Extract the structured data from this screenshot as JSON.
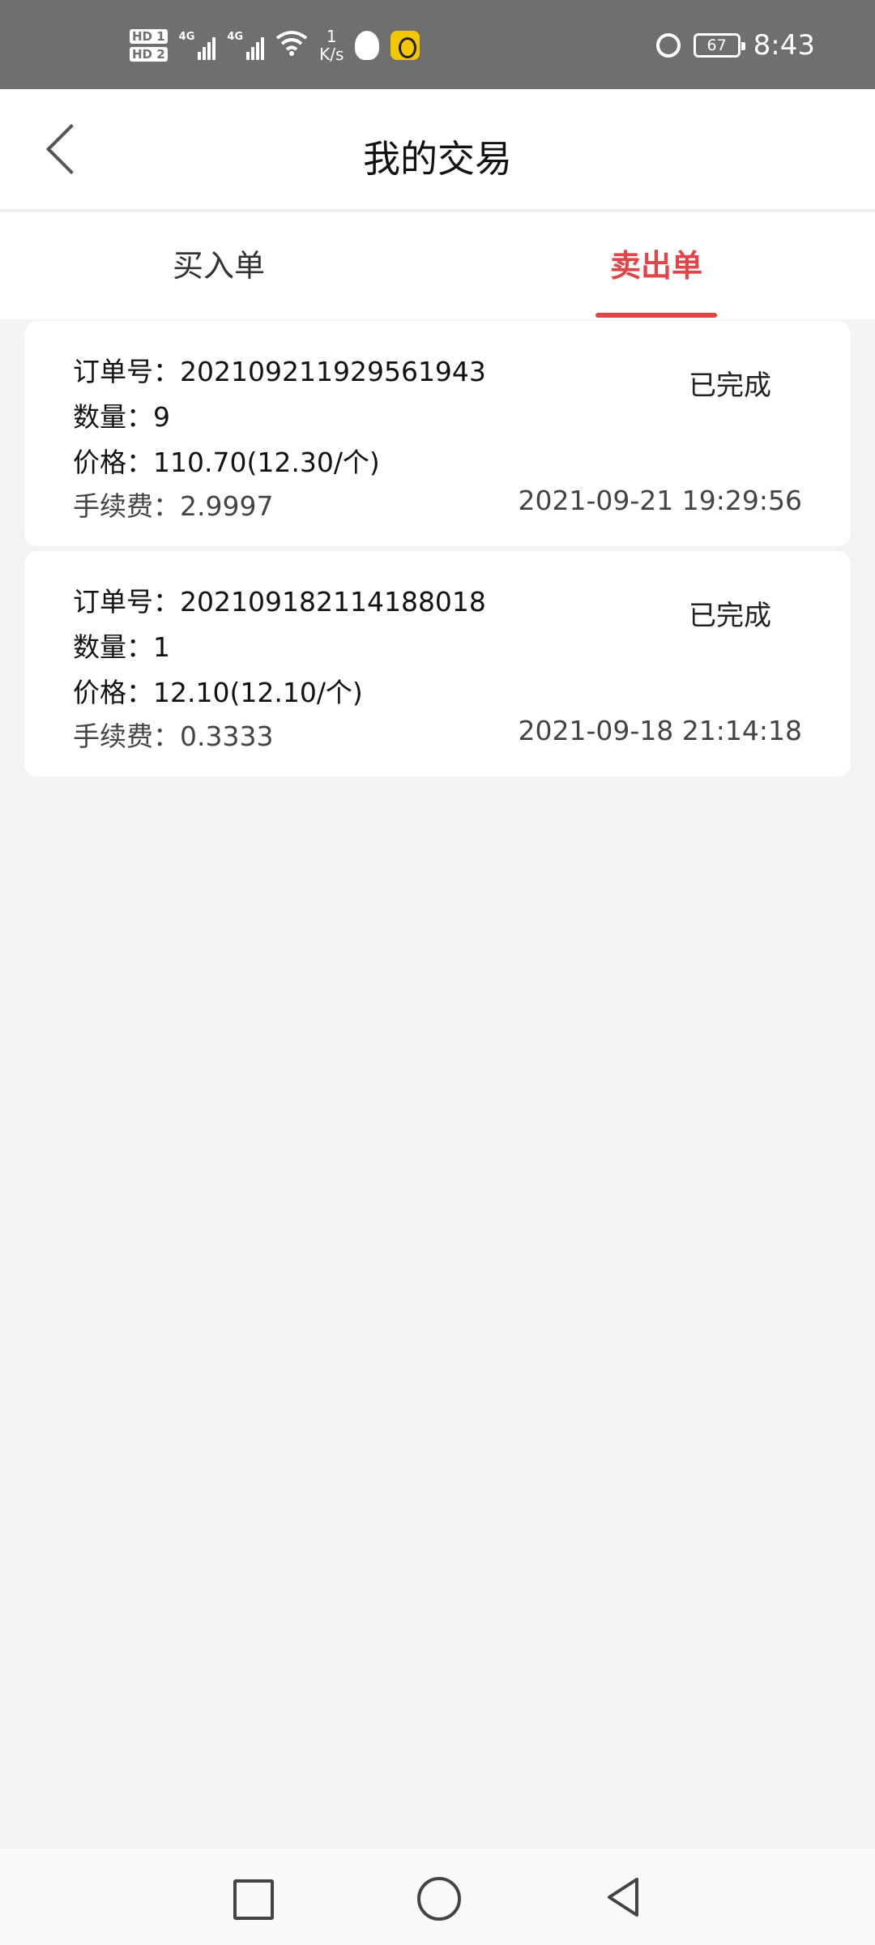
{
  "status_bar": {
    "hd1": "HD 1",
    "hd2": "HD 2",
    "net1": "4G",
    "net2": "4G",
    "speed_value": "1",
    "speed_unit": "K/s",
    "battery": "67",
    "time": "8:43"
  },
  "header": {
    "title": "我的交易"
  },
  "tabs": [
    {
      "label": "买入单",
      "active": false
    },
    {
      "label": "卖出单",
      "active": true
    }
  ],
  "orders": [
    {
      "order_no": "订单号：202109211929561943",
      "quantity": "数量：9",
      "price": "价格：110.70(12.30/个)",
      "fee": "手续费：2.9997",
      "status": "已完成",
      "time": "2021-09-21 19:29:56"
    },
    {
      "order_no": "订单号：202109182114188018",
      "quantity": "数量：1",
      "price": "价格：12.10(12.10/个)",
      "fee": "手续费：0.3333",
      "status": "已完成",
      "time": "2021-09-18 21:14:18"
    }
  ],
  "colors": {
    "accent": "#e04548",
    "status_bar_bg": "#6f6f6f",
    "page_bg": "#f3f3f3"
  },
  "icons": {
    "back": "chevron-left-icon",
    "nav_square": "recent-apps-icon",
    "nav_circle": "home-icon",
    "nav_triangle": "back-triangle-icon"
  }
}
